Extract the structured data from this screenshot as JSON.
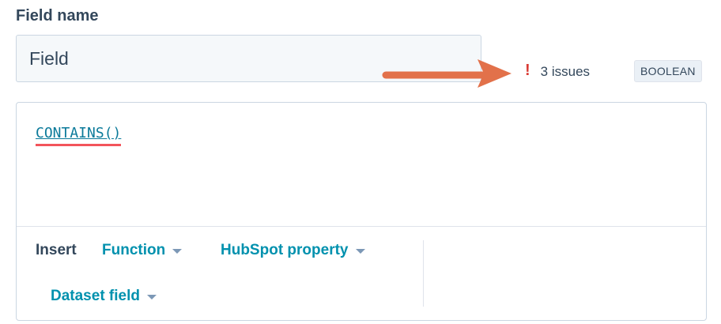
{
  "field": {
    "label": "Field name",
    "value": "Field"
  },
  "validation": {
    "icon": "exclamation-icon",
    "issues_text": "3 issues",
    "type_badge": "BOOLEAN",
    "error_color": "#d93b34"
  },
  "editor": {
    "code": "CONTAINS()"
  },
  "toolbar": {
    "insert_label": "Insert",
    "function_label": "Function",
    "hubspot_property_label": "HubSpot property",
    "dataset_field_label": "Dataset field"
  },
  "colors": {
    "link": "#0091ae",
    "code": "#0b7a9a",
    "annotation_arrow": "#e2714a",
    "text": "#33475b"
  }
}
